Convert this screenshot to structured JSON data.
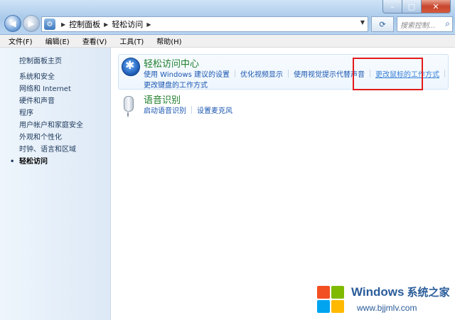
{
  "window": {
    "min_label": "–",
    "max_label": "□",
    "close_label": "✕"
  },
  "nav": {
    "back_label": "◀",
    "forward_label": "▶",
    "breadcrumbs": [
      "控制面板",
      "轻松访问"
    ],
    "search_placeholder": "搜索控制..."
  },
  "menu": [
    "文件(F)",
    "编辑(E)",
    "查看(V)",
    "工具(T)",
    "帮助(H)"
  ],
  "sidebar": {
    "home": "控制面板主页",
    "items": [
      "系统和安全",
      "网络和 Internet",
      "硬件和声音",
      "程序",
      "用户帐户和家庭安全",
      "外观和个性化",
      "时钟、语言和区域",
      "轻松访问"
    ],
    "current_index": 7
  },
  "categories": [
    {
      "title": "轻松访问中心",
      "links_row1": [
        "使用 Windows 建议的设置",
        "优化视频显示",
        "使用视觉提示代替声音",
        "更改鼠标的工作方式"
      ],
      "links_row2": [
        "更改键盘的工作方式"
      ],
      "icon": "ease-of-access-icon"
    },
    {
      "title": "语音识别",
      "links_row1": [
        "启动语音识别",
        "设置麦克风"
      ],
      "icon": "microphone-icon"
    }
  ],
  "watermark": {
    "brand": "Windows",
    "brand_cn": "系统之家",
    "url": "www.bjjmlv.com"
  },
  "colors": {
    "title_green": "#1e7d2a",
    "link_blue": "#1a56b0",
    "highlight_red": "#e31b1b"
  }
}
